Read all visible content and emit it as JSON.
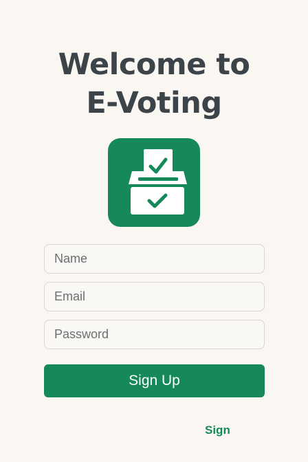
{
  "header": {
    "title_line1": "Welcome to",
    "title_line2": "E-Voting"
  },
  "logo": {
    "icon": "ballot-box-icon",
    "color": "#15895a"
  },
  "form": {
    "name_placeholder": "Name",
    "email_placeholder": "Email",
    "password_placeholder": "Password",
    "submit_label": "Sign Up"
  },
  "footer": {
    "signin_link": "Sign"
  },
  "colors": {
    "background": "#faf7f2",
    "accent": "#15895a",
    "title": "#3c4449"
  }
}
